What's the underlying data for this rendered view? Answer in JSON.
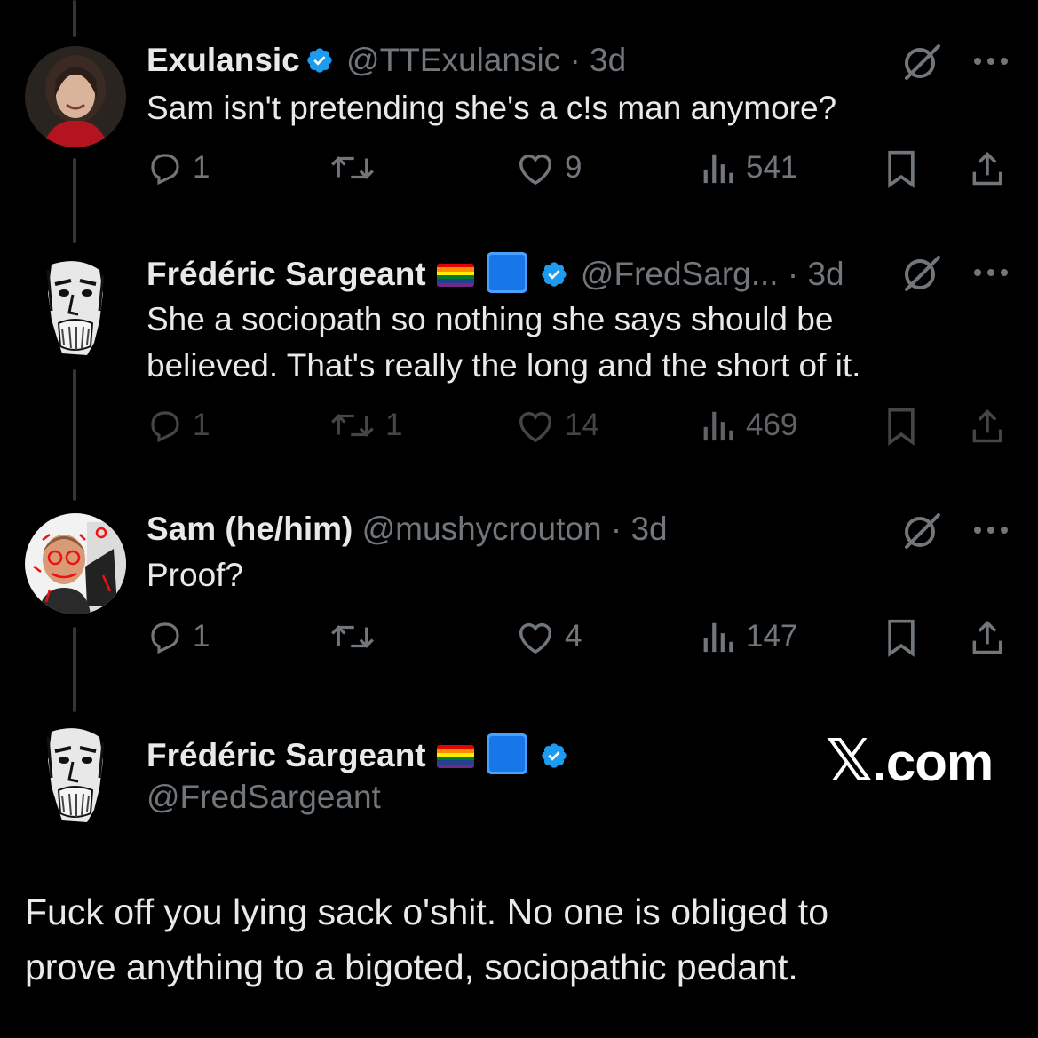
{
  "tweets": [
    {
      "name": "Exulansic",
      "handle": "@TTExulansic",
      "time": "· 3d",
      "text": "Sam isn't pretending she's a c!s man anymore?",
      "replies": "1",
      "reposts": "",
      "likes": "9",
      "views": "541"
    },
    {
      "name": "Frédéric Sargeant",
      "handle": "@FredSarg...",
      "time": "· 3d",
      "text_line1": "She a sociopath so nothing she says should be",
      "text_line2": "believed.  That's really the long and the short of it.",
      "replies": "1",
      "reposts": "1",
      "likes": "14",
      "views": "469"
    },
    {
      "name": "Sam (he/him)",
      "handle": "@mushycrouton",
      "time": "· 3d",
      "text": "Proof?",
      "replies": "1",
      "reposts": "",
      "likes": "4",
      "views": "147"
    }
  ],
  "main_tweet": {
    "name": "Frédéric Sargeant",
    "handle": "@FredSargeant",
    "text_line1": "Fuck off you lying sack o'shit.  No one is obliged to",
    "text_line2": "prove anything to a bigoted, sociopathic pedant."
  },
  "watermark": {
    "mark": "𝕏",
    "suffix": ".com"
  },
  "colors": {
    "background": "#000000",
    "text": "#e7e9ea",
    "muted": "#71767b",
    "verified": "#1d9bf0",
    "thread_line": "#333639"
  },
  "icons": [
    "verified-badge-icon",
    "grok-icon",
    "more-icon",
    "reply-icon",
    "repost-icon",
    "like-icon",
    "views-icon",
    "bookmark-icon",
    "share-icon",
    "pride-flag-icon",
    "blue-square-icon"
  ]
}
